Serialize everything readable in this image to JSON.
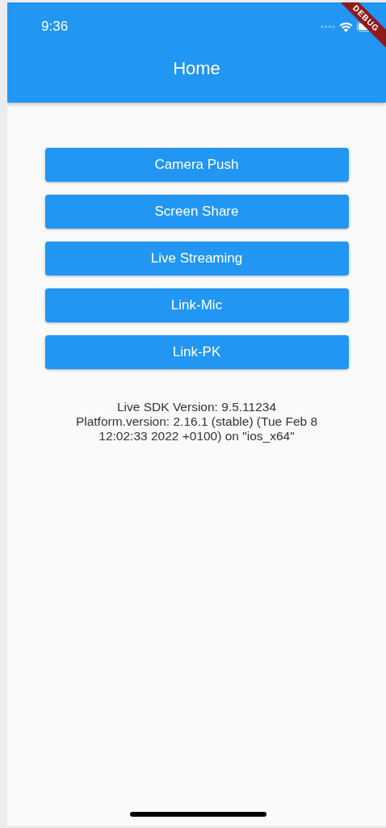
{
  "status_bar": {
    "time": "9:36"
  },
  "debug_banner": "DEBUG",
  "app_bar": {
    "title": "Home"
  },
  "buttons": [
    "Camera Push",
    "Screen Share",
    "Live Streaming",
    "Link-Mic",
    "Link-PK"
  ],
  "info": [
    "Live SDK Version: 9.5.11234",
    "Platform.version: 2.16.1 (stable) (Tue Feb 8 12:02:33 2022 +0100) on \"ios_x64\""
  ]
}
